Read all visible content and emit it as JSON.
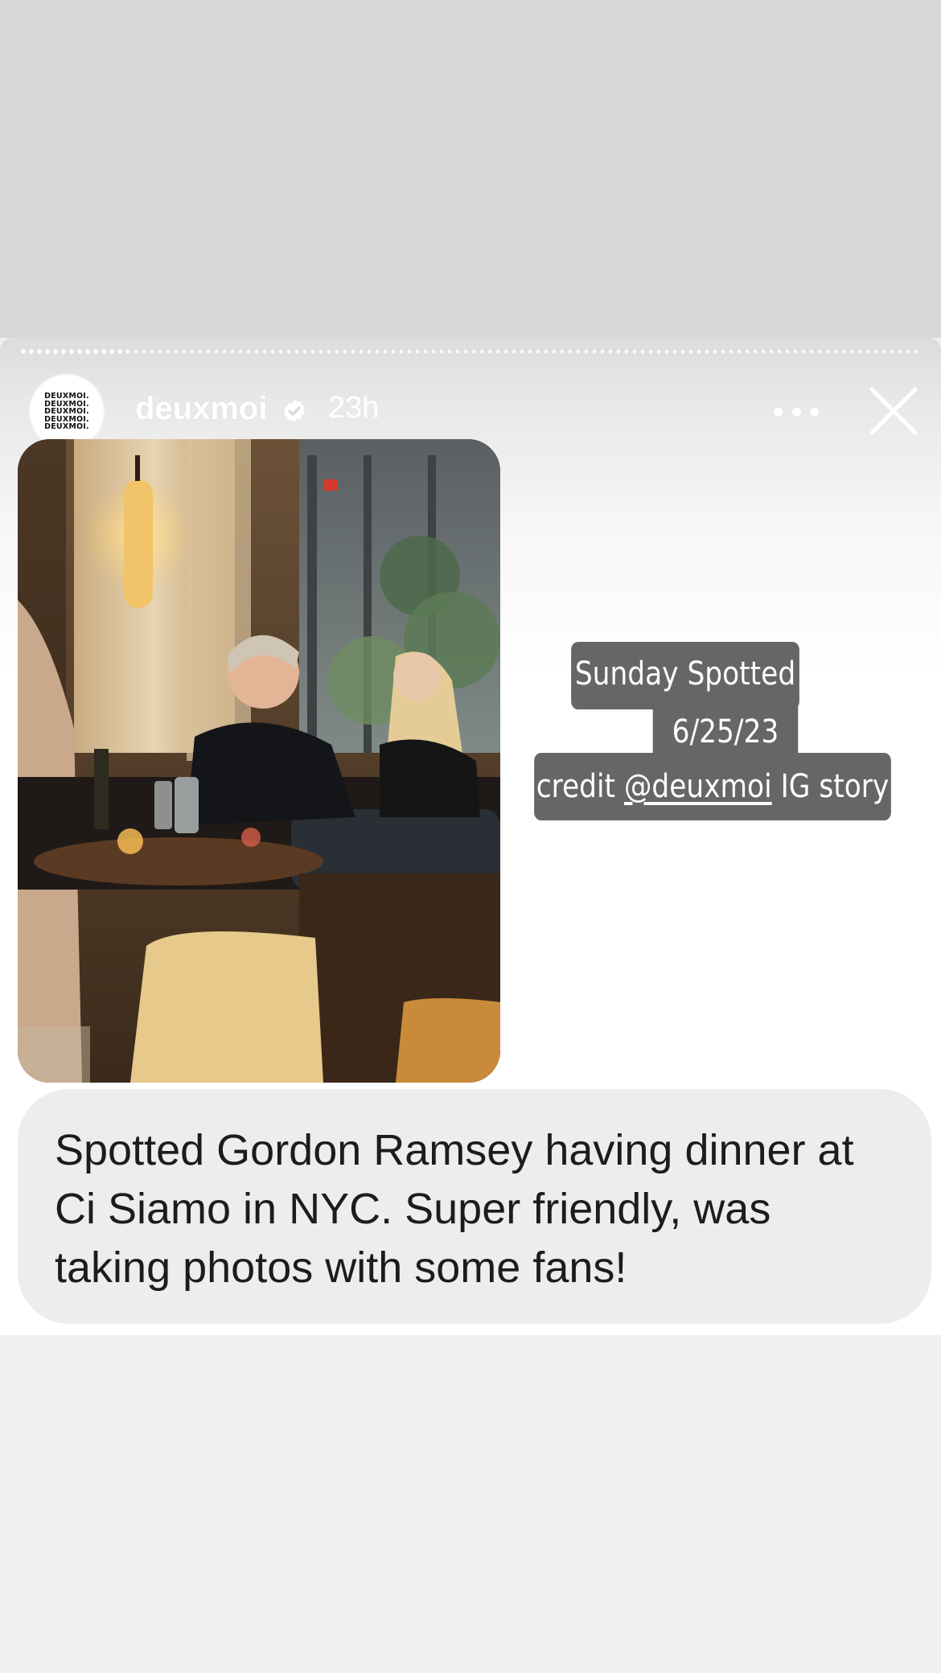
{
  "story": {
    "progress_fraction": 0.12,
    "account": {
      "avatar_text": [
        "DEUXMOI.",
        "DEUXMOI.",
        "DEUXMOI.",
        "DEUXMOI.",
        "DEUXMOI."
      ],
      "username": "deuxmoi",
      "verified": true,
      "timestamp": "23h"
    },
    "icons": {
      "verified": "verified-badge-icon",
      "more": "more-options-icon",
      "close": "close-icon"
    },
    "caption": {
      "line1": "Sunday Spotted",
      "line2": "6/25/23",
      "line3_prefix": "credit ",
      "line3_mention": "@deuxmoi",
      "line3_suffix": " IG story"
    },
    "message": "Spotted Gordon Ramsey having dinner at Ci Siamo in NYC. Super friendly, was taking photos with some fans!"
  },
  "colors": {
    "top_band": "#d7d7d7",
    "bottom_band": "#f0f0f0",
    "caption_bg": "#666666",
    "bubble_bg": "#ededed",
    "text_dark": "#1c1c1c"
  }
}
